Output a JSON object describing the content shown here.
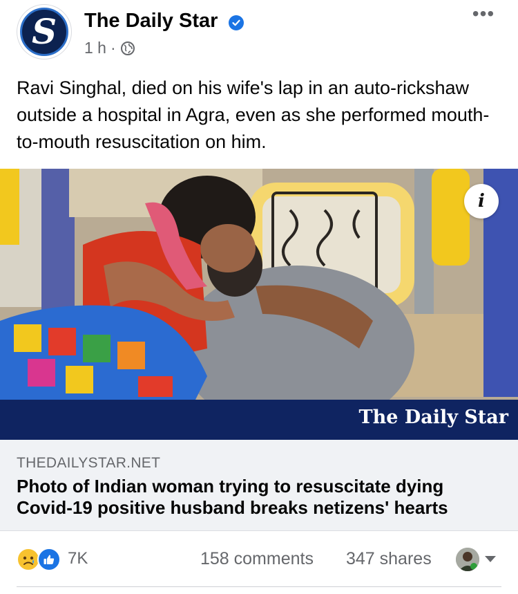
{
  "post": {
    "page_name": "The Daily Star",
    "time": "1 h",
    "caption": "Ravi Singhal, died on his wife's lap in an auto-rickshaw outside a hospital in Agra, even as she performed mouth-to-mouth resuscitation on him."
  },
  "photo": {
    "watermark": "The Daily Star",
    "info_label": "i"
  },
  "link_preview": {
    "domain": "THEDAILYSTAR.NET",
    "headline": "Photo of Indian woman trying to resuscitate dying Covid-19 positive husband breaks netizens' hearts"
  },
  "engagement": {
    "reaction_count": "7K",
    "comments": "158 comments",
    "shares": "347 shares"
  },
  "icons": {
    "verified": "verified-badge-icon",
    "privacy": "globe-icon",
    "more": "more-options-icon",
    "info": "info-icon",
    "reactions": [
      "sad-reaction-icon",
      "like-reaction-icon"
    ]
  },
  "colors": {
    "verified_blue": "#1b74e4",
    "watermark_band": "#0f2461",
    "secondary_text": "#65676b",
    "link_background": "#f0f2f5"
  }
}
